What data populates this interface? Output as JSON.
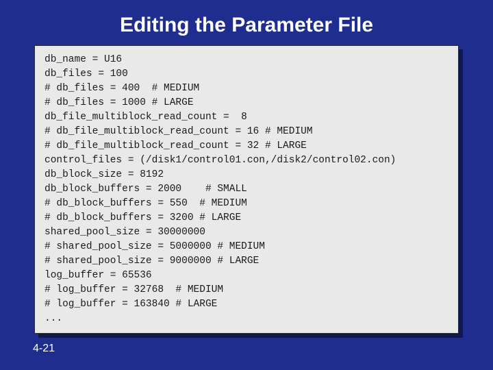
{
  "title": "Editing the Parameter File",
  "page_number": "4-21",
  "code_lines": [
    "db_name = U16",
    "db_files = 100",
    "# db_files = 400  # MEDIUM",
    "# db_files = 1000 # LARGE",
    "db_file_multiblock_read_count =  8",
    "# db_file_multiblock_read_count = 16 # MEDIUM",
    "# db_file_multiblock_read_count = 32 # LARGE",
    "control_files = (/disk1/control01.con,/disk2/control02.con)",
    "db_block_size = 8192",
    "db_block_buffers = 2000    # SMALL",
    "# db_block_buffers = 550  # MEDIUM",
    "# db_block_buffers = 3200 # LARGE",
    "shared_pool_size = 30000000",
    "# shared_pool_size = 5000000 # MEDIUM",
    "# shared_pool_size = 9000000 # LARGE",
    "log_buffer = 65536",
    "# log_buffer = 32768  # MEDIUM",
    "# log_buffer = 163840 # LARGE",
    "..."
  ]
}
